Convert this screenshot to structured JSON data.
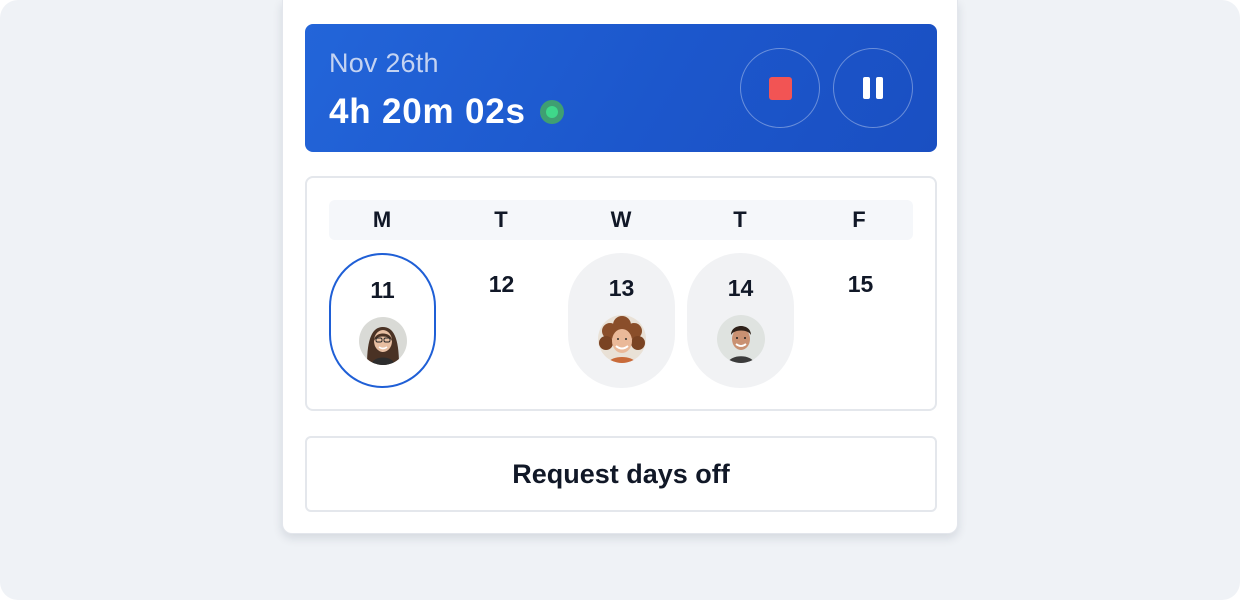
{
  "timer": {
    "date": "Nov 26th",
    "elapsed": "4h 20m 02s",
    "status": "running",
    "status_color": "#3fd88a",
    "stop_color": "#f25454",
    "accent_color": "#1f5fd6"
  },
  "calendar": {
    "weekdays": [
      "M",
      "T",
      "W",
      "T",
      "F"
    ],
    "days": [
      {
        "number": "11",
        "state": "selected",
        "avatar": "woman-long-hair-avatar"
      },
      {
        "number": "12",
        "state": "empty",
        "avatar": null
      },
      {
        "number": "13",
        "state": "booked",
        "avatar": "woman-curly-hair-avatar"
      },
      {
        "number": "14",
        "state": "booked",
        "avatar": "man-smiling-avatar"
      },
      {
        "number": "15",
        "state": "empty",
        "avatar": null
      }
    ]
  },
  "actions": {
    "request_label": "Request days off"
  }
}
